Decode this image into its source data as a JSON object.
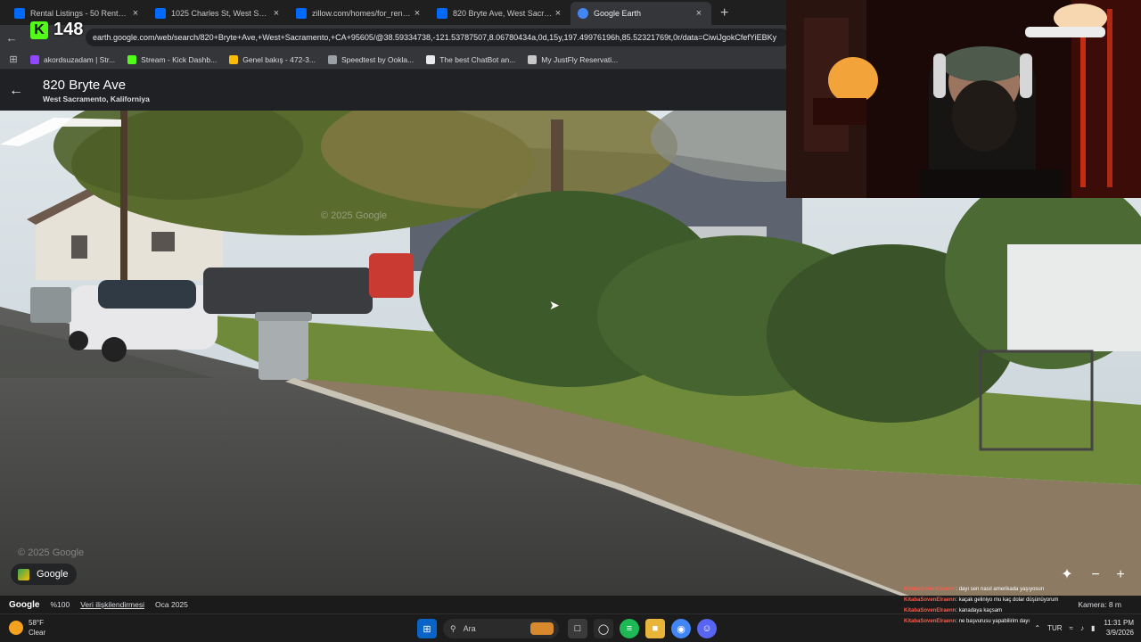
{
  "browser": {
    "tabs": [
      {
        "title": "Rental Listings - 50 Rentals | Zil",
        "favicon_color": "#006aff",
        "active": false
      },
      {
        "title": "1025 Charles St, West Sacramento",
        "favicon_color": "#006aff",
        "active": false
      },
      {
        "title": "zillow.com/homes/for_rent/?se",
        "favicon_color": "#006aff",
        "active": false
      },
      {
        "title": "820 Bryte Ave, West Sacramento",
        "favicon_color": "#006aff",
        "active": false
      },
      {
        "title": "Google Earth",
        "favicon_color": "#4285f4",
        "active": true
      }
    ],
    "close_glyph": "×",
    "new_tab_glyph": "+",
    "url": "earth.google.com/web/search/820+Bryte+Ave,+West+Sacramento,+CA+95605/@38.59334738,-121.53787507,8.06780434a,0d,15y,197.49976196h,85.52321769t,0r/data=CiwiJgokCfefYiEBKy",
    "bookmarks": [
      {
        "label": "akordsuzadam | Str...",
        "icon": "bookmark-twitch-icon",
        "color": "#9147ff"
      },
      {
        "label": "Stream - Kick Dashb...",
        "icon": "bookmark-kick-icon",
        "color": "#53fc18"
      },
      {
        "label": "Genel bakış - 472-3...",
        "icon": "bookmark-ads-icon",
        "color": "#fbbc05"
      },
      {
        "label": "Speedtest by Ookla...",
        "icon": "bookmark-speedtest-icon",
        "color": "#9aa0a6"
      },
      {
        "label": "The best ChatBot an...",
        "icon": "bookmark-chatbot-icon",
        "color": "#e8eaed"
      },
      {
        "label": "My JustFly Reservati...",
        "icon": "bookmark-justfly-icon",
        "color": "#c8c8c8"
      }
    ]
  },
  "kick_overlay": {
    "logo": "K",
    "viewers": "148"
  },
  "earth": {
    "place_name": "820 Bryte Ave",
    "place_subtitle": "West Sacramento, Kaliforniya",
    "watermark_top": "© 2025 Google",
    "watermark_bottom": "© 2025 Google",
    "badge_label": "Google",
    "footer": {
      "logo": "Google",
      "zoom": "%100",
      "relations": "Veri ilişkilendirmesi",
      "date": "Oca 2025",
      "camera": "Kamera: 8 m"
    }
  },
  "chat": [
    {
      "user": "KitabaSovenElraenn",
      "text": ": dayı sen nasıl amerikada yaşıyosun"
    },
    {
      "user": "KitabaSovenElraenn",
      "text": ": kaçak geliniyo mu kaç dolar düşünüyorum"
    },
    {
      "user": "KitabaSovenElraenn",
      "text": ": kanadaya kaçsam"
    },
    {
      "user": "KitabaSovenElraenn",
      "text": ": ne başvurusu yapabilirim dayı"
    }
  ],
  "taskbar": {
    "weather_temp": "58°F",
    "weather_desc": "Clear",
    "search_label": "Ara",
    "language": "TUR",
    "time": "11:31 PM",
    "date": "3/9/2026"
  }
}
